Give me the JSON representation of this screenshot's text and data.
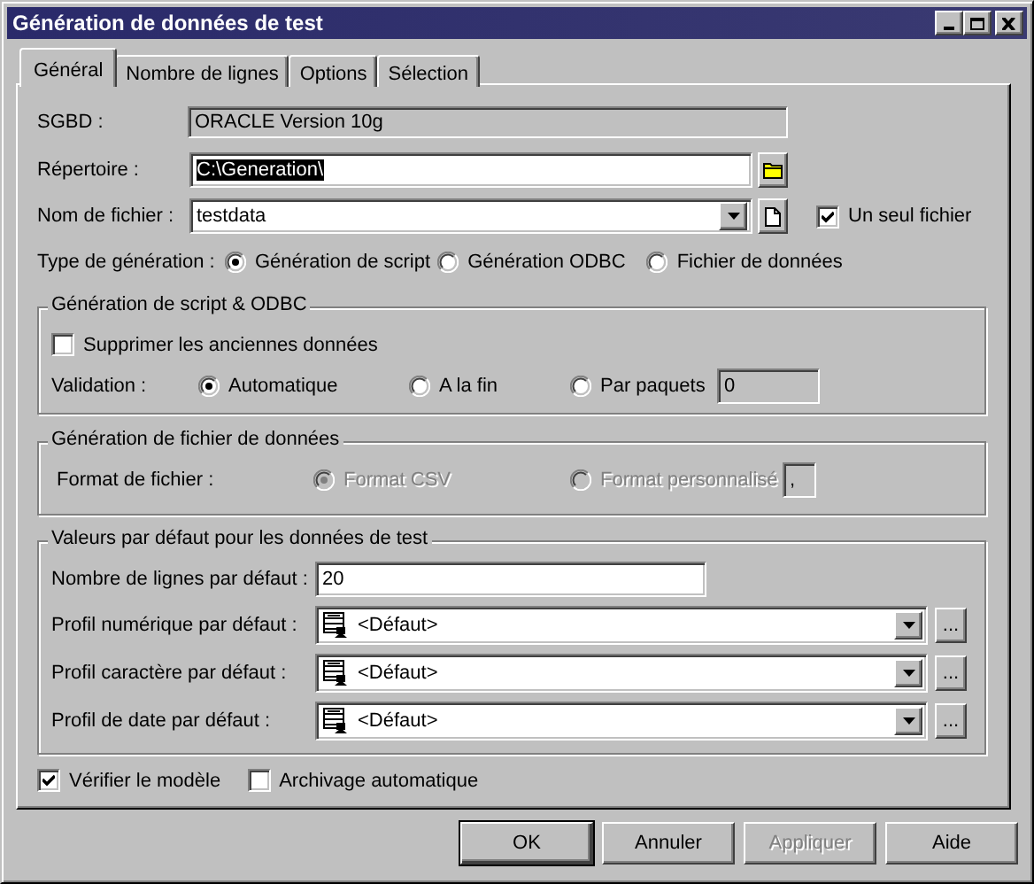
{
  "window": {
    "title": "Génération de données de test"
  },
  "tabs": [
    {
      "label": "Général",
      "selected": true
    },
    {
      "label": "Nombre de lignes",
      "selected": false
    },
    {
      "label": "Options",
      "selected": false
    },
    {
      "label": "Sélection",
      "selected": false
    }
  ],
  "general": {
    "dbms": {
      "label": "SGBD :",
      "value": "ORACLE Version 10g"
    },
    "directory": {
      "label": "Répertoire :",
      "value": "C:\\Generation\\",
      "text_selected": true
    },
    "file_name": {
      "label": "Nom de fichier :",
      "value": "testdata"
    },
    "single_file": {
      "label": "Un seul fichier",
      "checked": true
    },
    "generation_type": {
      "label": "Type de génération :",
      "options": [
        {
          "label": "Génération de script",
          "selected": true
        },
        {
          "label": "Génération ODBC",
          "selected": false
        },
        {
          "label": "Fichier de données",
          "selected": false
        }
      ]
    }
  },
  "script_odbc": {
    "title": "Génération de script & ODBC",
    "delete_old": {
      "label": "Supprimer les anciennes données",
      "checked": false
    },
    "validation": {
      "label": "Validation :",
      "options": [
        {
          "label": "Automatique",
          "selected": true
        },
        {
          "label": "A la fin",
          "selected": false
        },
        {
          "label": "Par paquets",
          "selected": false
        }
      ],
      "packet_size": "0"
    }
  },
  "data_file": {
    "title": "Génération de fichier de données",
    "format": {
      "label": "Format de fichier :",
      "disabled": true,
      "options": [
        {
          "label": "Format CSV",
          "selected": true
        },
        {
          "label": "Format personnalisé",
          "selected": false
        }
      ],
      "separator": ","
    }
  },
  "defaults": {
    "title": "Valeurs par défaut pour les données de test",
    "row_count": {
      "label": "Nombre de lignes par défaut :",
      "value": "20"
    },
    "profiles": [
      {
        "label": "Profil numérique par défaut :",
        "value": "<Défaut>",
        "browse": "..."
      },
      {
        "label": "Profil caractère par défaut :",
        "value": "<Défaut>",
        "browse": "..."
      },
      {
        "label": "Profil de date par défaut :",
        "value": "<Défaut>",
        "browse": "..."
      }
    ]
  },
  "options": [
    {
      "label": "Vérifier le modèle",
      "checked": true
    },
    {
      "label": "Archivage automatique",
      "checked": false
    }
  ],
  "buttons": [
    {
      "label": "OK",
      "default": true,
      "disabled": false
    },
    {
      "label": "Annuler",
      "default": false,
      "disabled": false
    },
    {
      "label": "Appliquer",
      "default": false,
      "disabled": true
    },
    {
      "label": "Aide",
      "default": false,
      "disabled": false
    }
  ]
}
